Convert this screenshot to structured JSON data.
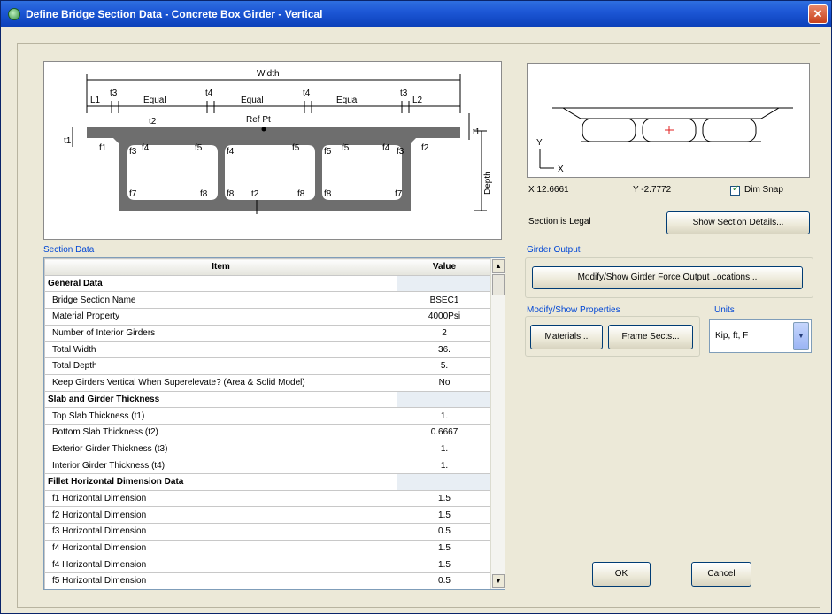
{
  "window": {
    "title": "Define Bridge Section Data - Concrete Box Girder - Vertical",
    "close_glyph": "✕"
  },
  "diagram": {
    "labels": {
      "width": "Width",
      "l1": "L1",
      "t3a": "t3",
      "equal1": "Equal",
      "t4a": "t4",
      "equal2": "Equal",
      "t4b": "t4",
      "equal3": "Equal",
      "t3b": "t3",
      "l2": "L2",
      "t2": "t2",
      "refpt": "Ref Pt",
      "t1": "t1",
      "depth": "Depth",
      "f1a": "f1",
      "f3a": "f3",
      "f4a": "f4",
      "f4b": "f4",
      "f5a": "f5",
      "f5b": "f5",
      "f5c": "f5",
      "f5d": "f5",
      "f4c": "f4",
      "f3b": "f3",
      "f2a": "f2",
      "f7a": "f7",
      "f8a": "f8",
      "f8b": "f8",
      "f8c": "f8",
      "f8d": "f8",
      "f7b": "f7",
      "t2b": "t2"
    }
  },
  "preview": {
    "axis_y": "Y",
    "axis_x": "X",
    "x_value": "X  12.6661",
    "y_value": "Y  -2.7772",
    "dim_snap": "Dim Snap",
    "legal_status": "Section is Legal",
    "show_details_button": "Show Section Details..."
  },
  "section_data": {
    "heading": "Section Data",
    "col_item": "Item",
    "col_value": "Value",
    "rows": [
      {
        "item": "General Data",
        "value": "",
        "group": true
      },
      {
        "item": "Bridge Section Name",
        "value": "BSEC1"
      },
      {
        "item": "Material Property",
        "value": "4000Psi"
      },
      {
        "item": "Number of Interior Girders",
        "value": "2"
      },
      {
        "item": "Total Width",
        "value": "36."
      },
      {
        "item": "Total Depth",
        "value": "5."
      },
      {
        "item": "Keep Girders Vertical When Superelevate? (Area & Solid Model)",
        "value": "No"
      },
      {
        "item": "Slab and Girder Thickness",
        "value": "",
        "group": true
      },
      {
        "item": "Top Slab Thickness (t1)",
        "value": "1."
      },
      {
        "item": "Bottom Slab Thickness (t2)",
        "value": "0.6667"
      },
      {
        "item": "Exterior Girder Thickness (t3)",
        "value": "1."
      },
      {
        "item": "Interior Girder Thickness (t4)",
        "value": "1."
      },
      {
        "item": "Fillet Horizontal Dimension Data",
        "value": "",
        "group": true
      },
      {
        "item": "f1 Horizontal Dimension",
        "value": "1.5"
      },
      {
        "item": "f2 Horizontal Dimension",
        "value": "1.5"
      },
      {
        "item": "f3 Horizontal Dimension",
        "value": "0.5"
      },
      {
        "item": "f4 Horizontal Dimension",
        "value": "1.5"
      },
      {
        "item": "f4 Horizontal Dimension",
        "value": "1.5"
      },
      {
        "item": "f5 Horizontal Dimension",
        "value": "0.5"
      }
    ]
  },
  "girder_output": {
    "heading": "Girder Output",
    "modify_button": "Modify/Show Girder Force Output Locations..."
  },
  "properties": {
    "heading": "Modify/Show Properties",
    "materials_button": "Materials...",
    "frame_sects_button": "Frame Sects..."
  },
  "units": {
    "heading": "Units",
    "value": "Kip, ft, F"
  },
  "footer": {
    "ok": "OK",
    "cancel": "Cancel"
  },
  "colors": {
    "section_fill": "#6e6e6e",
    "title_blue": "#1d57d6",
    "preview_red": "#e02020"
  }
}
